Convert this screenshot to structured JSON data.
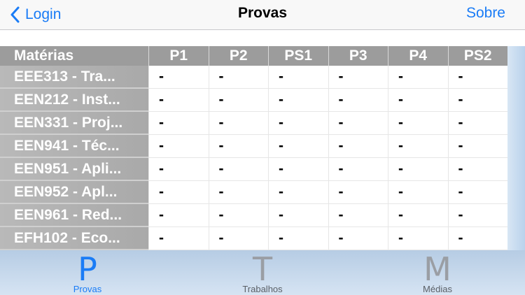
{
  "nav": {
    "back_label": "Login",
    "title": "Provas",
    "right_label": "Sobre"
  },
  "table": {
    "headers": [
      "Matérias",
      "P1",
      "P2",
      "PS1",
      "P3",
      "P4",
      "PS2"
    ],
    "rows": [
      {
        "subject": "EEE313 - Tra...",
        "grades": [
          "-",
          "-",
          "-",
          "-",
          "-",
          "-"
        ]
      },
      {
        "subject": "EEN212 - Inst...",
        "grades": [
          "-",
          "-",
          "-",
          "-",
          "-",
          "-"
        ]
      },
      {
        "subject": "EEN331 - Proj...",
        "grades": [
          "-",
          "-",
          "-",
          "-",
          "-",
          "-"
        ]
      },
      {
        "subject": "EEN941 - Téc...",
        "grades": [
          "-",
          "-",
          "-",
          "-",
          "-",
          "-"
        ]
      },
      {
        "subject": "EEN951 - Apli...",
        "grades": [
          "-",
          "-",
          "-",
          "-",
          "-",
          "-"
        ]
      },
      {
        "subject": "EEN952 - Apl...",
        "grades": [
          "-",
          "-",
          "-",
          "-",
          "-",
          "-"
        ]
      },
      {
        "subject": "EEN961 - Red...",
        "grades": [
          "-",
          "-",
          "-",
          "-",
          "-",
          "-"
        ]
      },
      {
        "subject": "EFH102 - Eco...",
        "grades": [
          "-",
          "-",
          "-",
          "-",
          "-",
          "-"
        ]
      }
    ]
  },
  "tabbar": {
    "tabs": [
      {
        "glyph": "P",
        "label": "Provas",
        "active": true
      },
      {
        "glyph": "T",
        "label": "Trabalhos",
        "active": false
      },
      {
        "glyph": "M",
        "label": "Médias",
        "active": false
      }
    ]
  },
  "colors": {
    "accent": "#1a7cf6",
    "header_bg": "#9c9c9c",
    "subject_bg": "#b0b0b0",
    "tabbar_bg": "#c4d8ee"
  }
}
